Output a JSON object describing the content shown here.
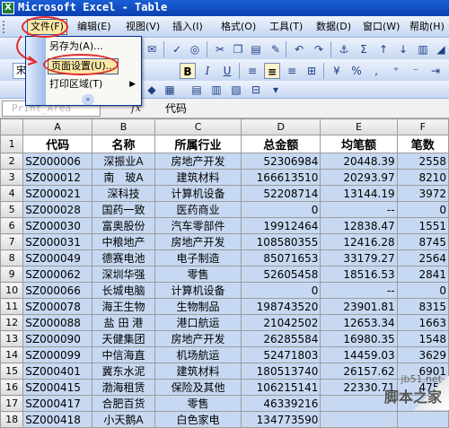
{
  "window": {
    "title": "Microsoft Excel - Table",
    "app_icon": "X"
  },
  "menubar": {
    "items": [
      "文件(F)",
      "编辑(E)",
      "视图(V)",
      "插入(I)",
      "格式(O)",
      "工具(T)",
      "数据(D)",
      "窗口(W)",
      "帮助(H)"
    ]
  },
  "file_menu": {
    "items": [
      {
        "label": "另存为(A)...",
        "has_submenu": false,
        "highlighted": false
      },
      {
        "label": "页面设置(U)...",
        "has_submenu": false,
        "highlighted": true
      },
      {
        "label": "打印区域(T)",
        "has_submenu": true,
        "highlighted": false
      }
    ],
    "more": "»"
  },
  "toolbar_format": {
    "font": "宋",
    "bold": "B",
    "italic": "I",
    "underline": "U",
    "currency": "%"
  },
  "formula_bar": {
    "name_box": "Print_Area",
    "fx": "fx",
    "value": "代码"
  },
  "columns": [
    "A",
    "B",
    "C",
    "D",
    "E",
    "F"
  ],
  "rows": [
    {
      "n": "1",
      "cells": [
        "代码",
        "名称",
        "所属行业",
        "总金额",
        "均笔额",
        "笔数"
      ]
    },
    {
      "n": "2",
      "cells": [
        "SZ000006",
        "深振业A",
        "房地产开发",
        "52306984",
        "20448.39",
        "2558"
      ]
    },
    {
      "n": "3",
      "cells": [
        "SZ000012",
        "南　玻A",
        "建筑材料",
        "166613510",
        "20293.97",
        "8210"
      ]
    },
    {
      "n": "4",
      "cells": [
        "SZ000021",
        "深科技",
        "计算机设备",
        "52208714",
        "13144.19",
        "3972"
      ]
    },
    {
      "n": "5",
      "cells": [
        "SZ000028",
        "国药一致",
        "医药商业",
        "0",
        "--",
        "0"
      ]
    },
    {
      "n": "6",
      "cells": [
        "SZ000030",
        "富奥股份",
        "汽车零部件",
        "19912464",
        "12838.47",
        "1551"
      ]
    },
    {
      "n": "7",
      "cells": [
        "SZ000031",
        "中粮地产",
        "房地产开发",
        "108580355",
        "12416.28",
        "8745"
      ]
    },
    {
      "n": "8",
      "cells": [
        "SZ000049",
        "德赛电池",
        "电子制造",
        "85071653",
        "33179.27",
        "2564"
      ]
    },
    {
      "n": "9",
      "cells": [
        "SZ000062",
        "深圳华强",
        "零售",
        "52605458",
        "18516.53",
        "2841"
      ]
    },
    {
      "n": "10",
      "cells": [
        "SZ000066",
        "长城电脑",
        "计算机设备",
        "0",
        "--",
        "0"
      ]
    },
    {
      "n": "11",
      "cells": [
        "SZ000078",
        "海王生物",
        "生物制品",
        "198743520",
        "23901.81",
        "8315"
      ]
    },
    {
      "n": "12",
      "cells": [
        "SZ000088",
        "盐 田 港",
        "港口航运",
        "21042502",
        "12653.34",
        "1663"
      ]
    },
    {
      "n": "13",
      "cells": [
        "SZ000090",
        "天健集团",
        "房地产开发",
        "26285584",
        "16980.35",
        "1548"
      ]
    },
    {
      "n": "14",
      "cells": [
        "SZ000099",
        "中信海直",
        "机场航运",
        "52471803",
        "14459.03",
        "3629"
      ]
    },
    {
      "n": "15",
      "cells": [
        "SZ000401",
        "冀东水泥",
        "建筑材料",
        "180513740",
        "26157.62",
        "6901"
      ]
    },
    {
      "n": "16",
      "cells": [
        "SZ000415",
        "渤海租赁",
        "保险及其他",
        "106215141",
        "22330.71",
        "4756"
      ]
    },
    {
      "n": "17",
      "cells": [
        "SZ000417",
        "合肥百货",
        "零售",
        "46339216",
        "",
        ""
      ]
    },
    {
      "n": "18",
      "cells": [
        "SZ000418",
        "小天鹅A",
        "白色家电",
        "134773590",
        "",
        ""
      ]
    }
  ],
  "watermark": {
    "site": "jb51.net",
    "brand": "脚本之家"
  },
  "colors": {
    "selection": "#c7d9f2",
    "annotation": "#e22b2b",
    "menu_highlight": "#fbe7a5"
  }
}
